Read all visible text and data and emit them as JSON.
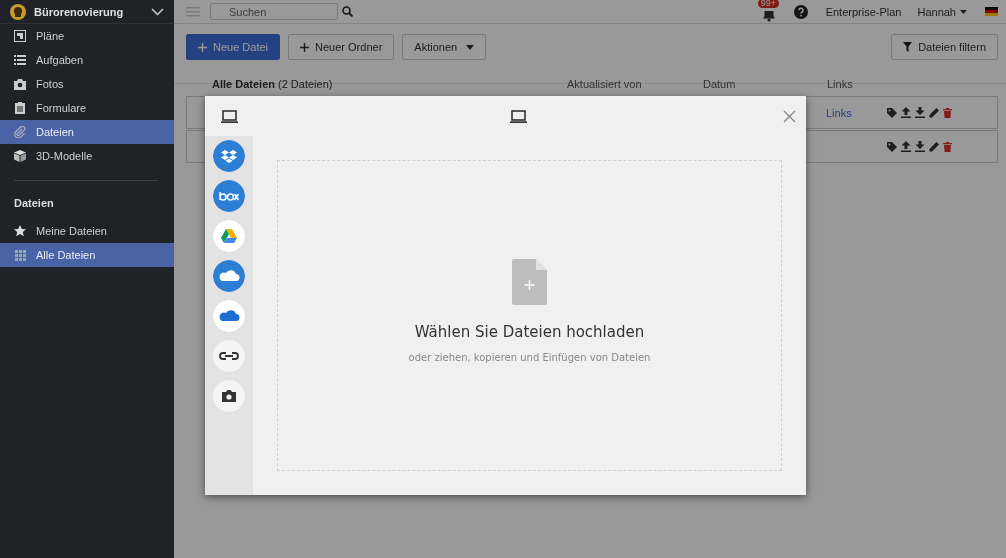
{
  "workspace": {
    "name": "Bürorenovierung"
  },
  "sidebar": {
    "items": [
      {
        "label": "Pläne",
        "selected": false
      },
      {
        "label": "Aufgaben",
        "selected": false
      },
      {
        "label": "Fotos",
        "selected": false
      },
      {
        "label": "Formulare",
        "selected": false
      },
      {
        "label": "Dateien",
        "selected": true
      },
      {
        "label": "3D-Modelle",
        "selected": false
      }
    ],
    "section_title": "Dateien",
    "section_items": [
      {
        "label": "Meine Dateien",
        "selected": false
      },
      {
        "label": "Alle Dateien",
        "selected": true
      }
    ]
  },
  "topbar": {
    "search": {
      "placeholder": "Suchen"
    },
    "notification_badge": "99+",
    "plan": "Enterprise-Plan",
    "user": "Hannah"
  },
  "toolbar": {
    "buttons": [
      {
        "label": "Neue Datei",
        "kind": "primary"
      },
      {
        "label": "Neuer Ordner",
        "kind": "plus"
      },
      {
        "label": "Aktionen",
        "kind": "dropdown"
      }
    ],
    "filter_button": "Dateien filtern"
  },
  "table": {
    "columns": [
      "**Alle Dateien** (2 Dateien)",
      "Aktualisiert von",
      "Datum",
      "Links"
    ],
    "rows": [
      {
        "kind": "file",
        "link": "Links"
      },
      {
        "kind": "file"
      }
    ]
  },
  "upload_modal": {
    "sources": [
      {
        "kind": "dropbox"
      },
      {
        "kind": "box"
      },
      {
        "kind": "drive"
      },
      {
        "kind": "onedrive"
      },
      {
        "kind": "onedrive-business"
      },
      {
        "kind": "link"
      },
      {
        "kind": "camera"
      }
    ],
    "title": "Wählen Sie Dateien hochladen",
    "subtitle": "oder ziehen, kopieren und Einfügen von Dateien"
  }
}
